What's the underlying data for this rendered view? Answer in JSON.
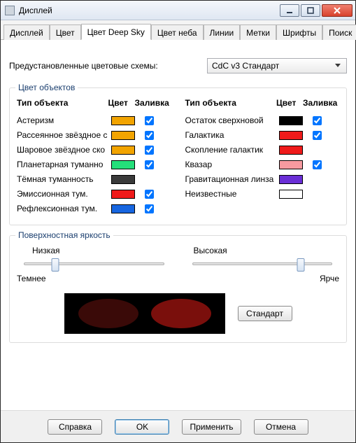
{
  "window": {
    "title": "Дисплей"
  },
  "tabs": [
    "Дисплей",
    "Цвет",
    "Цвет Deep Sky",
    "Цвет неба",
    "Линии",
    "Метки",
    "Шрифты",
    "Поиск"
  ],
  "active_tab": 2,
  "preset": {
    "label": "Предустановленные цветовые схемы:",
    "value": "CdC v3 Стандарт"
  },
  "group_objects": {
    "title": "Цвет объектов",
    "headers": {
      "type": "Тип объекта",
      "color": "Цвет",
      "fill": "Заливка"
    },
    "left": [
      {
        "name": "Астеризм",
        "color": "#f2a400",
        "fill": true
      },
      {
        "name": "Рассеянное звёздное с",
        "color": "#f2a400",
        "fill": true
      },
      {
        "name": "Шаровое звёздное ско",
        "color": "#f2a400",
        "fill": true
      },
      {
        "name": "Планетарная туманно",
        "color": "#24df7a",
        "fill": true
      },
      {
        "name": "Тёмная туманность",
        "color": "#3a3a3a",
        "fill": null
      },
      {
        "name": "Эмиссионная тум.",
        "color": "#ef1a1a",
        "fill": true
      },
      {
        "name": "Рефлексионная тум.",
        "color": "#1766e0",
        "fill": true
      }
    ],
    "right": [
      {
        "name": "Остаток сверхновой",
        "color": "#000000",
        "fill": true
      },
      {
        "name": "Галактика",
        "color": "#ef1a1a",
        "fill": true
      },
      {
        "name": "Скопление галактик",
        "color": "#ef1a1a",
        "fill": null
      },
      {
        "name": "Квазар",
        "color": "#f79aa0",
        "fill": true
      },
      {
        "name": "Гравитационная линза",
        "color": "#6a2ed6",
        "fill": null
      },
      {
        "name": "Неизвестные",
        "color": "#ffffff",
        "fill": null
      }
    ]
  },
  "group_sb": {
    "title": "Поверхностная яркость",
    "low": "Низкая",
    "high": "Высокая",
    "darker": "Темнее",
    "brighter": "Ярче",
    "standard": "Стандарт",
    "slider_low_pct": 22,
    "slider_high_pct": 78,
    "preview": {
      "c1": "#3a0a08",
      "c2": "#7a0f0c"
    }
  },
  "buttons": {
    "help": "Справка",
    "ok": "OK",
    "apply": "Применить",
    "cancel": "Отмена"
  }
}
